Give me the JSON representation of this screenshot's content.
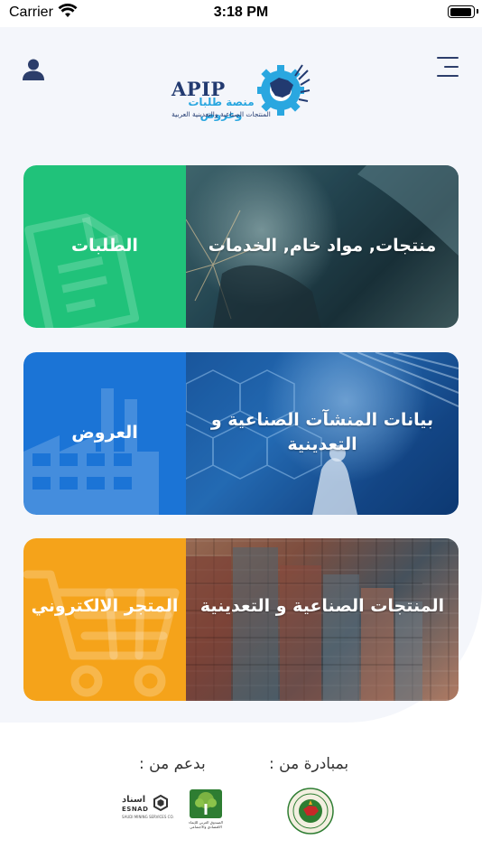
{
  "status_bar": {
    "carrier": "Carrier",
    "time": "3:18 PM"
  },
  "header": {
    "logo": {
      "brand": "APIP",
      "title_ar": "منصة طلبات وعروض",
      "subtitle_ar": "المنتجات الصناعية والتعدينية العربية"
    },
    "icons": {
      "left": "user-icon",
      "right": "hamburger-menu-icon"
    }
  },
  "cards": [
    {
      "photo_label": "منتجات, مواد خام, الخدمات",
      "tile_label": "الطلبات",
      "tile_icon": "document-icon",
      "tile_color": "#20c27a"
    },
    {
      "photo_label": "بيانات المنشآت الصناعية و التعدينية",
      "tile_label": "العروض",
      "tile_icon": "factory-icon",
      "tile_color": "#1b74d6"
    },
    {
      "photo_label": "المنتجات الصناعية و التعدينية",
      "tile_label": "المتجر الالكتروني",
      "tile_icon": "shopping-cart-icon",
      "tile_color": "#f5a31a"
    }
  ],
  "sponsors": {
    "initiative_label": "بمبادرة من :",
    "support_label": "بدعم من :",
    "esnad": {
      "name_ar": "اسناد",
      "name_en": "ESNAD",
      "tagline": "SAUDI MINING SERVICES CO."
    },
    "fund_text": "الصندوق العربي للإنماء الاقتصادي والاجتماعي"
  }
}
